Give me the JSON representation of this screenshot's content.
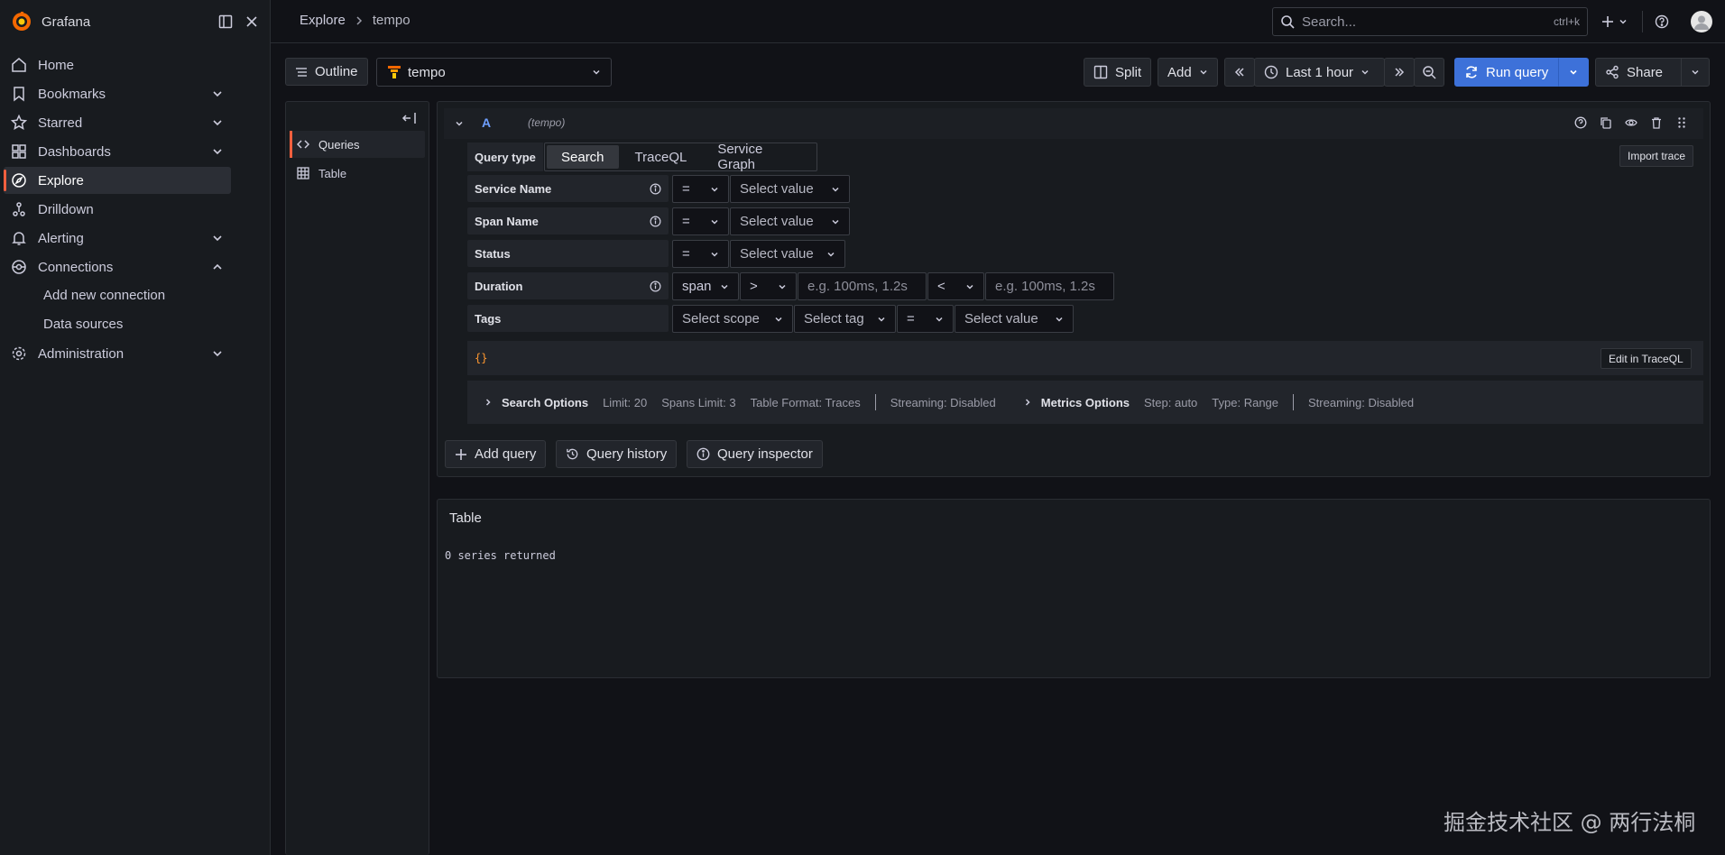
{
  "app": {
    "name": "Grafana"
  },
  "sidebar": {
    "items": [
      {
        "label": "Home",
        "icon": "home-icon",
        "expandable": false
      },
      {
        "label": "Bookmarks",
        "icon": "bookmark-icon",
        "expandable": true
      },
      {
        "label": "Starred",
        "icon": "star-icon",
        "expandable": true
      },
      {
        "label": "Dashboards",
        "icon": "apps-icon",
        "expandable": true
      },
      {
        "label": "Explore",
        "icon": "compass-icon",
        "expandable": false,
        "active": true
      },
      {
        "label": "Drilldown",
        "icon": "drilldown-icon",
        "expandable": false
      },
      {
        "label": "Alerting",
        "icon": "bell-icon",
        "expandable": true
      },
      {
        "label": "Connections",
        "icon": "plug-icon",
        "expandable": true,
        "expanded": true
      },
      {
        "label": "Administration",
        "icon": "cog-icon",
        "expandable": true
      }
    ],
    "connections_children": [
      "Add new connection",
      "Data sources"
    ]
  },
  "breadcrumb": {
    "root": "Explore",
    "current": "tempo"
  },
  "search": {
    "placeholder": "Search...",
    "shortcut": "ctrl+k"
  },
  "toolbar": {
    "outline_label": "Outline",
    "datasource": "tempo",
    "split_label": "Split",
    "add_label": "Add",
    "time_range": "Last 1 hour",
    "run_query_label": "Run query",
    "share_label": "Share"
  },
  "outline": {
    "items": [
      "Queries",
      "Table"
    ]
  },
  "query": {
    "ref_id": "A",
    "datasource_hint": "(tempo)",
    "import_trace_label": "Import trace",
    "query_type_label": "Query type",
    "query_types": [
      "Search",
      "TraceQL",
      "Service Graph"
    ],
    "selected_query_type": "Search",
    "fields": {
      "service_name": "Service Name",
      "span_name": "Span Name",
      "status": "Status",
      "duration": "Duration",
      "tags": "Tags"
    },
    "operators": {
      "eq": "=",
      "gt": ">",
      "lt": "<"
    },
    "select_value_ph": "Select value",
    "select_scope_ph": "Select scope",
    "select_tag_ph": "Select tag",
    "duration_scope": "span",
    "duration_placeholder": "e.g. 100ms, 1.2s",
    "traceql_preview": "{}",
    "edit_in_traceql_label": "Edit in TraceQL",
    "search_options": {
      "title": "Search Options",
      "limit": "Limit: 20",
      "spans_limit": "Spans Limit: 3",
      "table_format": "Table Format: Traces",
      "streaming": "Streaming: Disabled"
    },
    "metrics_options": {
      "title": "Metrics Options",
      "step": "Step: auto",
      "type": "Type: Range",
      "streaming": "Streaming: Disabled"
    },
    "add_query_label": "Add query",
    "query_history_label": "Query history",
    "query_inspector_label": "Query inspector"
  },
  "result": {
    "title": "Table",
    "message": "0 series returned"
  },
  "watermark": "掘金技术社区 @ 两行法桐",
  "colors": {
    "accent": "#3d71d9",
    "brand": "#f55f3e",
    "background": "#111217",
    "panel": "#181b1f"
  }
}
